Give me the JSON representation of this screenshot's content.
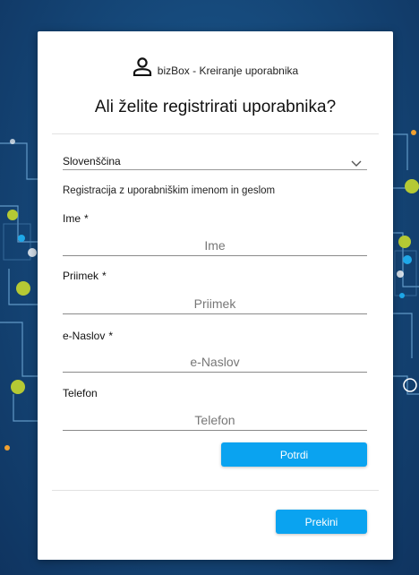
{
  "header": {
    "brand_text": "bizBox - Kreiranje uporabnika",
    "title": "Ali želite registrirati uporabnika?"
  },
  "language": {
    "selected": "Slovenščina"
  },
  "subtitle": "Registracija z uporabniškim imenom in geslom",
  "fields": {
    "ime": {
      "label": "Ime",
      "required": "*",
      "placeholder": "Ime"
    },
    "priimek": {
      "label": "Priimek",
      "required": "*",
      "placeholder": "Priimek"
    },
    "naslov": {
      "label": "e-Naslov",
      "required": "*",
      "placeholder": "e-Naslov"
    },
    "telefon": {
      "label": "Telefon",
      "placeholder": "Telefon"
    }
  },
  "buttons": {
    "confirm": "Potrdi",
    "cancel": "Prekini"
  },
  "colors": {
    "accent": "#0aa3f0",
    "background": "#164a7c",
    "dot_green": "#b5c934",
    "dot_blue": "#1ea7e8"
  }
}
